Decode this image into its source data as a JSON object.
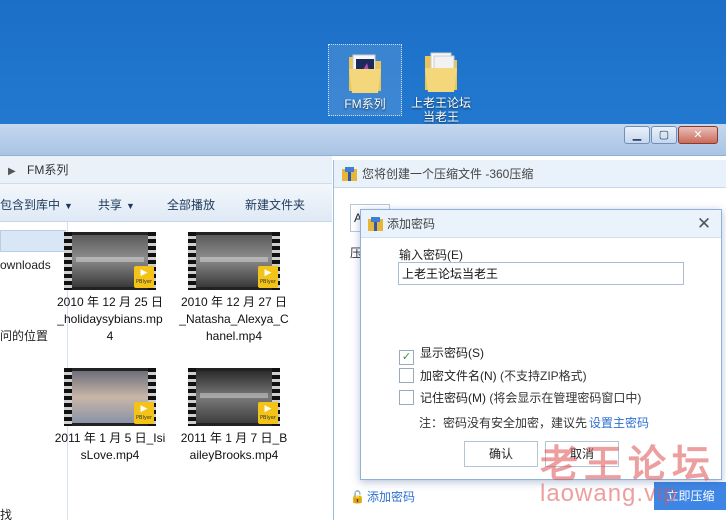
{
  "desktop": {
    "icons": [
      {
        "label": "FM系列"
      },
      {
        "label": "上老王论坛当老王"
      }
    ]
  },
  "explorer": {
    "address": "FM系列",
    "toolbar": {
      "include_library": "包含到库中",
      "share": "共享",
      "play_all": "全部播放",
      "new_folder": "新建文件夹"
    },
    "nav": {
      "downloads": "ownloads",
      "recent_places": "问的位置",
      "more": "找"
    },
    "files": [
      {
        "name": "2010 年 12 月 25 日_holidaysybians.mp4",
        "thumb": "film-thumb"
      },
      {
        "name": "2010 年 12 月 27 日_Natasha_Alexya_Chanel.mp4",
        "thumb": "film-thumb"
      },
      {
        "name": "2011 年 1 月 5 日_IsisLove.mp4",
        "thumb": "film-thumb"
      },
      {
        "name": "2011 年 1 月 7 日_BaileyBrooks.mp4",
        "thumb": "film-thumb"
      }
    ],
    "badge": {
      "label": "PBlyer",
      "play_glyph": "▶"
    },
    "window_buttons": {
      "minimize": "▁",
      "maximize": "▢",
      "close": "✕"
    }
  },
  "compressor": {
    "title": "您将创建一个压缩文件 -360压缩",
    "field_value": "A",
    "side_label": "压",
    "add_password_link": "添加密码",
    "ok_button": "立即压缩"
  },
  "dialog": {
    "title": "添加密码",
    "close_glyph": "✕",
    "password_label": "输入密码(E)",
    "password_value": "上老王论坛当老王",
    "options": [
      {
        "label": "显示密码(S)",
        "note": "",
        "checked": true
      },
      {
        "label": "加密文件名(N)",
        "note": " (不支持ZIP格式)",
        "checked": false
      },
      {
        "label": "记住密码(M)",
        "note": " (将会显示在管理密码窗口中)",
        "checked": false
      }
    ],
    "hint_text": "注：密码没有安全加密，建议先",
    "hint_link": "设置主密码",
    "confirm": "确认",
    "cancel": "取消"
  },
  "watermark": {
    "cn": "老王论坛",
    "en": "laowang.vip"
  },
  "colors": {
    "desktop_bg": "#2a84d9",
    "link": "#2c6fd1",
    "primary_button": "#3e86e6",
    "watermark": "#de5050"
  }
}
